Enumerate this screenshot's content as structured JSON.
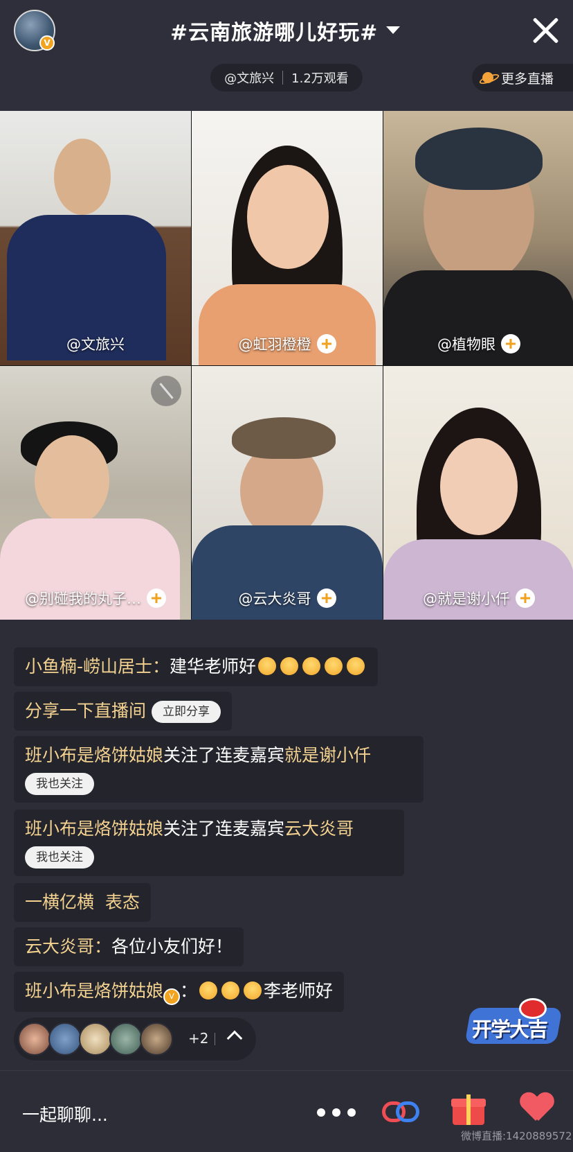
{
  "header": {
    "title": "#云南旅游哪儿好玩#",
    "host_handle": "@文旅兴",
    "viewer_count": "1.2万观看",
    "more_live_label": "更多直播"
  },
  "participants": [
    {
      "handle": "@文旅兴",
      "follow": false
    },
    {
      "handle": "@虹羽橙橙",
      "follow": true
    },
    {
      "handle": "@植物眼",
      "follow": true
    },
    {
      "handle": "@别碰我的丸子…",
      "follow": true,
      "muted": true
    },
    {
      "handle": "@云大炎哥",
      "follow": true
    },
    {
      "handle": "@就是谢小仟",
      "follow": true
    }
  ],
  "chat": {
    "m1_user": "小鱼楠-崂山居士：",
    "m1_text": "建华老师好",
    "m2_text": "分享一下直播间",
    "m2_button": "立即分享",
    "m3_user": "班小布是烙饼姑娘",
    "m3_mid": "关注了连麦嘉宾",
    "m3_target": "就是谢小仟",
    "m3_button": "我也关注",
    "m4_user": "班小布是烙饼姑娘",
    "m4_mid": "关注了连麦嘉宾",
    "m4_target": "云大炎哥",
    "m4_button": "我也关注",
    "m5_text": "一横亿横  表态",
    "m6_user": "云大炎哥：",
    "m6_text": "各位小友们好！",
    "m7_user": "班小布是烙饼姑娘",
    "m7_colon": "：",
    "m7_text": "李老师好"
  },
  "viewers": {
    "extra_count": "+2"
  },
  "brand_badge": "开学大吉",
  "bottom": {
    "chat_placeholder": "一起聊聊...",
    "watermark": "微博直播:1420889572"
  },
  "colors": {
    "accent_gold": "#f4d290",
    "badge_orange": "#f2a31f",
    "heart": "#f25a63"
  }
}
